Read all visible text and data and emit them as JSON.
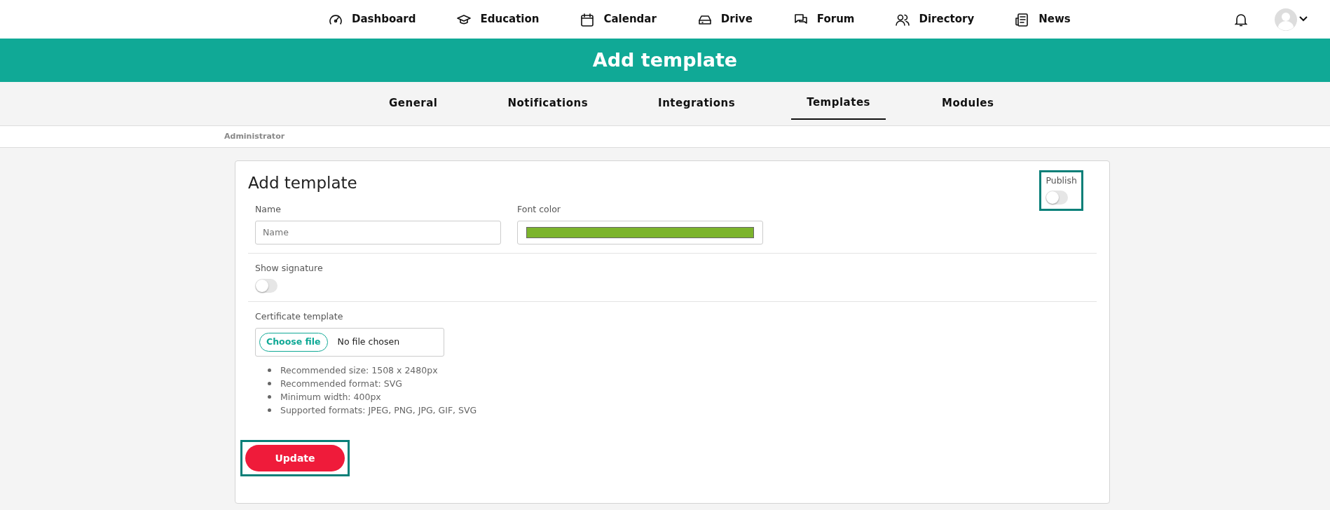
{
  "top_nav": {
    "items": [
      {
        "label": "Dashboard"
      },
      {
        "label": "Education"
      },
      {
        "label": "Calendar"
      },
      {
        "label": "Drive"
      },
      {
        "label": "Forum"
      },
      {
        "label": "Directory"
      },
      {
        "label": "News"
      }
    ]
  },
  "header": {
    "title": "Add template"
  },
  "tabs": [
    {
      "label": "General",
      "selected": false
    },
    {
      "label": "Notifications",
      "selected": false
    },
    {
      "label": "Integrations",
      "selected": false
    },
    {
      "label": "Templates",
      "selected": true
    },
    {
      "label": "Modules",
      "selected": false
    }
  ],
  "breadcrumb": "Administrator",
  "form": {
    "title": "Add template",
    "publish": {
      "label": "Publish",
      "on": false,
      "highlighted": true
    },
    "name": {
      "label": "Name",
      "placeholder": "Name"
    },
    "font_color": {
      "label": "Font color",
      "color": "#7cb42c"
    },
    "show_signature": {
      "label": "Show signature",
      "on": false
    },
    "certificate": {
      "label": "Certificate template",
      "button": "Choose file",
      "status": "No file chosen",
      "notes": [
        "Recommended size: 1508 x 2480px",
        "Recommended format: SVG",
        "Minimum width: 400px",
        "Supported formats: JPEG, PNG, JPG, GIF, SVG"
      ]
    },
    "submit": {
      "label": "Update",
      "highlighted": true
    }
  }
}
